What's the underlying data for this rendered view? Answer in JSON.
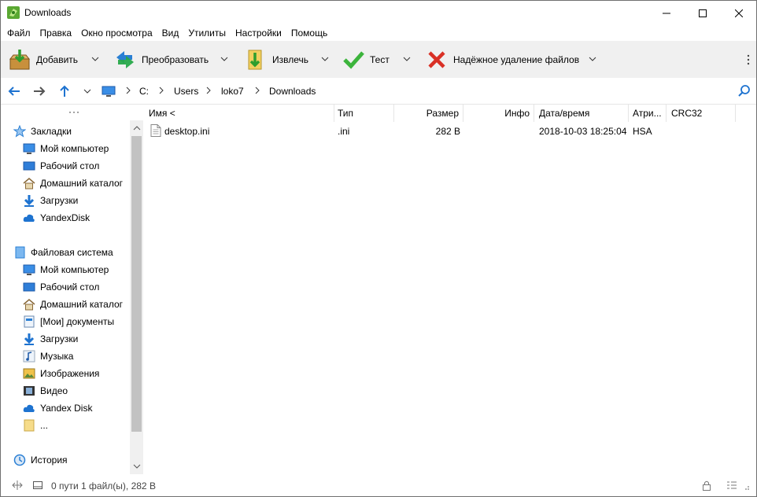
{
  "window": {
    "title": "Downloads"
  },
  "menu": [
    "Файл",
    "Правка",
    "Окно просмотра",
    "Вид",
    "Утилиты",
    "Настройки",
    "Помощь"
  ],
  "toolbar": {
    "add_label": "Добавить",
    "convert_label": "Преобразовать",
    "extract_label": "Извлечь",
    "test_label": "Тест",
    "wipe_label": "Надёжное удаление файлов"
  },
  "address": {
    "crumbs": [
      "C:",
      "Users",
      "loko7",
      "Downloads"
    ]
  },
  "sidebar": {
    "more": "···",
    "bookmarks": {
      "title": "Закладки",
      "items": [
        "Мой компьютер",
        "Рабочий стол",
        "Домашний каталог",
        "Загрузки",
        "YandexDisk"
      ]
    },
    "filesystem": {
      "title": "Файловая система",
      "items": [
        "Мой компьютер",
        "Рабочий стол",
        "Домашний каталог",
        "[Мои] документы",
        "Загрузки",
        "Музыка",
        "Изображения",
        "Видео",
        "Yandex Disk",
        "..."
      ]
    },
    "history": {
      "title": "История"
    }
  },
  "columns": [
    "Имя <",
    "Тип",
    "Размер",
    "Инфо",
    "Дата/время",
    "Атри...",
    "CRC32"
  ],
  "files": [
    {
      "name": "desktop.ini",
      "type": ".ini",
      "size": "282 B",
      "info": "",
      "datetime": "2018-10-03 18:25:04",
      "attr": "HSA",
      "crc": ""
    }
  ],
  "status": {
    "text": "0 пути 1 файл(ы), 282 B"
  },
  "colors": {
    "accent": "#1e73d0",
    "toolbar_bg": "#f0f0f0",
    "green": "#3cb43c",
    "red": "#d93025"
  }
}
